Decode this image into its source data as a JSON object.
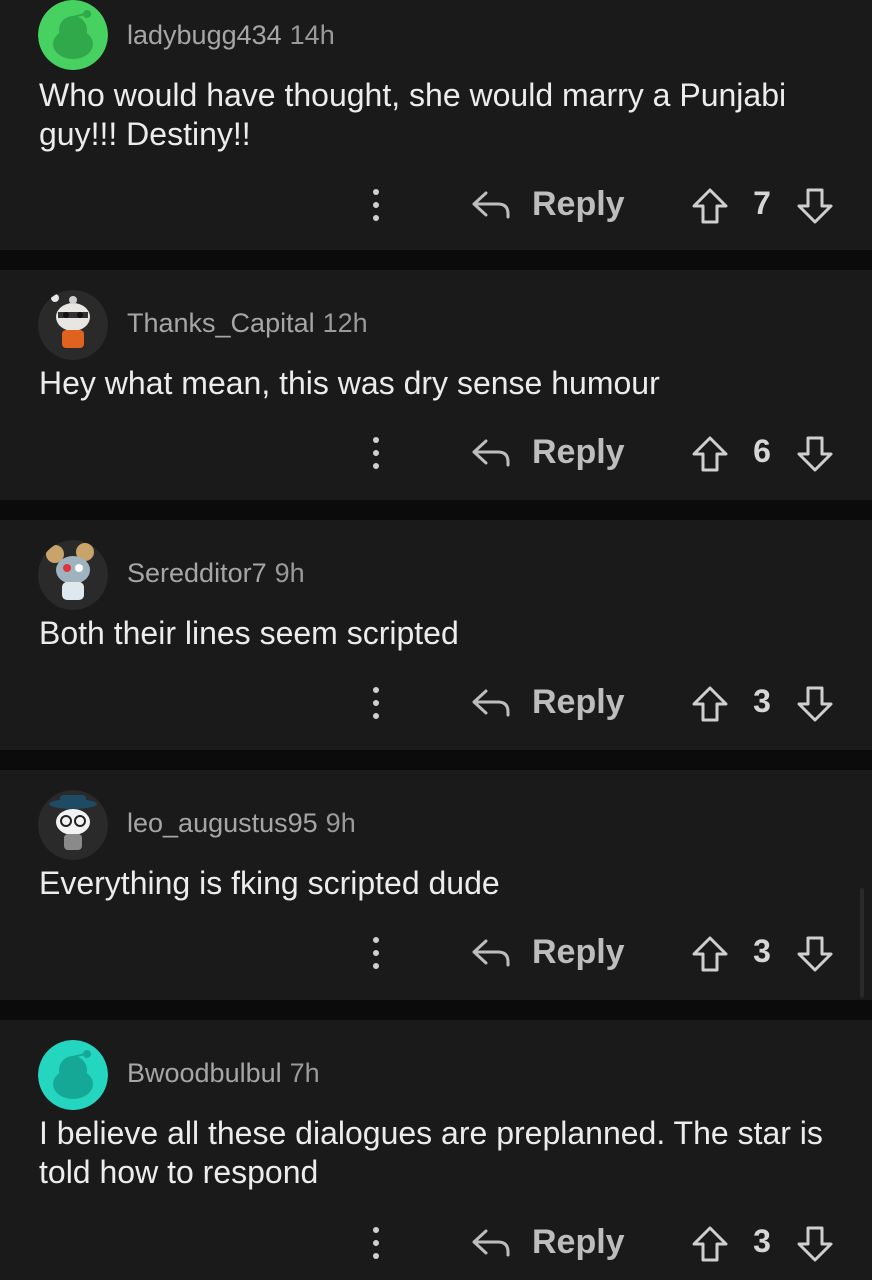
{
  "comments": [
    {
      "author": "ladybugg434",
      "time": "14h",
      "text": "Who would have thought, she would marry a Punjabi guy!!! Destiny!!",
      "reply_label": "Reply",
      "score": "7",
      "avatar_color": "#46d160"
    },
    {
      "author": "Thanks_Capital",
      "time": "12h",
      "text": "Hey what mean, this was dry sense humour",
      "reply_label": "Reply",
      "score": "6",
      "avatar_color": "#2a2a2a"
    },
    {
      "author": "Seredditor7",
      "time": "9h",
      "text": "Both their lines seem scripted",
      "reply_label": "Reply",
      "score": "3",
      "avatar_color": "#2a2a2a"
    },
    {
      "author": "leo_augustus95",
      "time": "9h",
      "text": "Everything is fking scripted dude",
      "reply_label": "Reply",
      "score": "3",
      "avatar_color": "#2a2a2a"
    },
    {
      "author": "Bwoodbulbul",
      "time": "7h",
      "text": "I believe all these dialogues are preplanned. The star is told how to respond",
      "reply_label": "Reply",
      "score": "3",
      "avatar_color": "#24d6c0"
    }
  ],
  "icons": {
    "more": "more-vertical-icon",
    "reply": "reply-arrow-icon",
    "upvote": "upvote-arrow-icon",
    "downvote": "downvote-arrow-icon"
  },
  "colors": {
    "background": "#0b0b0b",
    "card": "#1a1a1b",
    "text": "#ececec",
    "meta": "#9a9a9a"
  }
}
